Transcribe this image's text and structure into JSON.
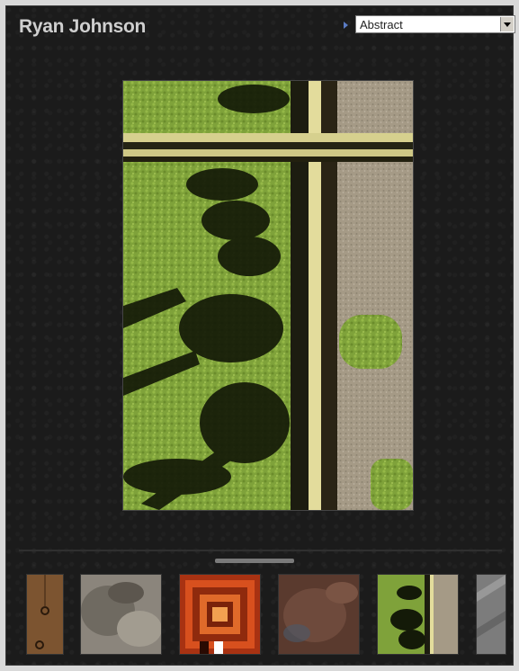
{
  "header": {
    "title": "Ryan Johnson"
  },
  "gallery_select": {
    "selected": "Abstract"
  },
  "main_photo": {
    "icon": "photo-shadow-grass"
  },
  "thumbnails": [
    {
      "name": "thumb-1",
      "icon": "rusty-metal"
    },
    {
      "name": "thumb-2",
      "icon": "grey-texture"
    },
    {
      "name": "thumb-3",
      "icon": "orange-frames",
      "selected": true
    },
    {
      "name": "thumb-4",
      "icon": "brown-texture"
    },
    {
      "name": "thumb-5",
      "icon": "shadow-grass"
    },
    {
      "name": "thumb-6",
      "icon": "grey-partial"
    }
  ],
  "colors": {
    "background": "#1b1b1b",
    "title": "#cfcfcf",
    "select_arrow": "#5b7cc4"
  }
}
